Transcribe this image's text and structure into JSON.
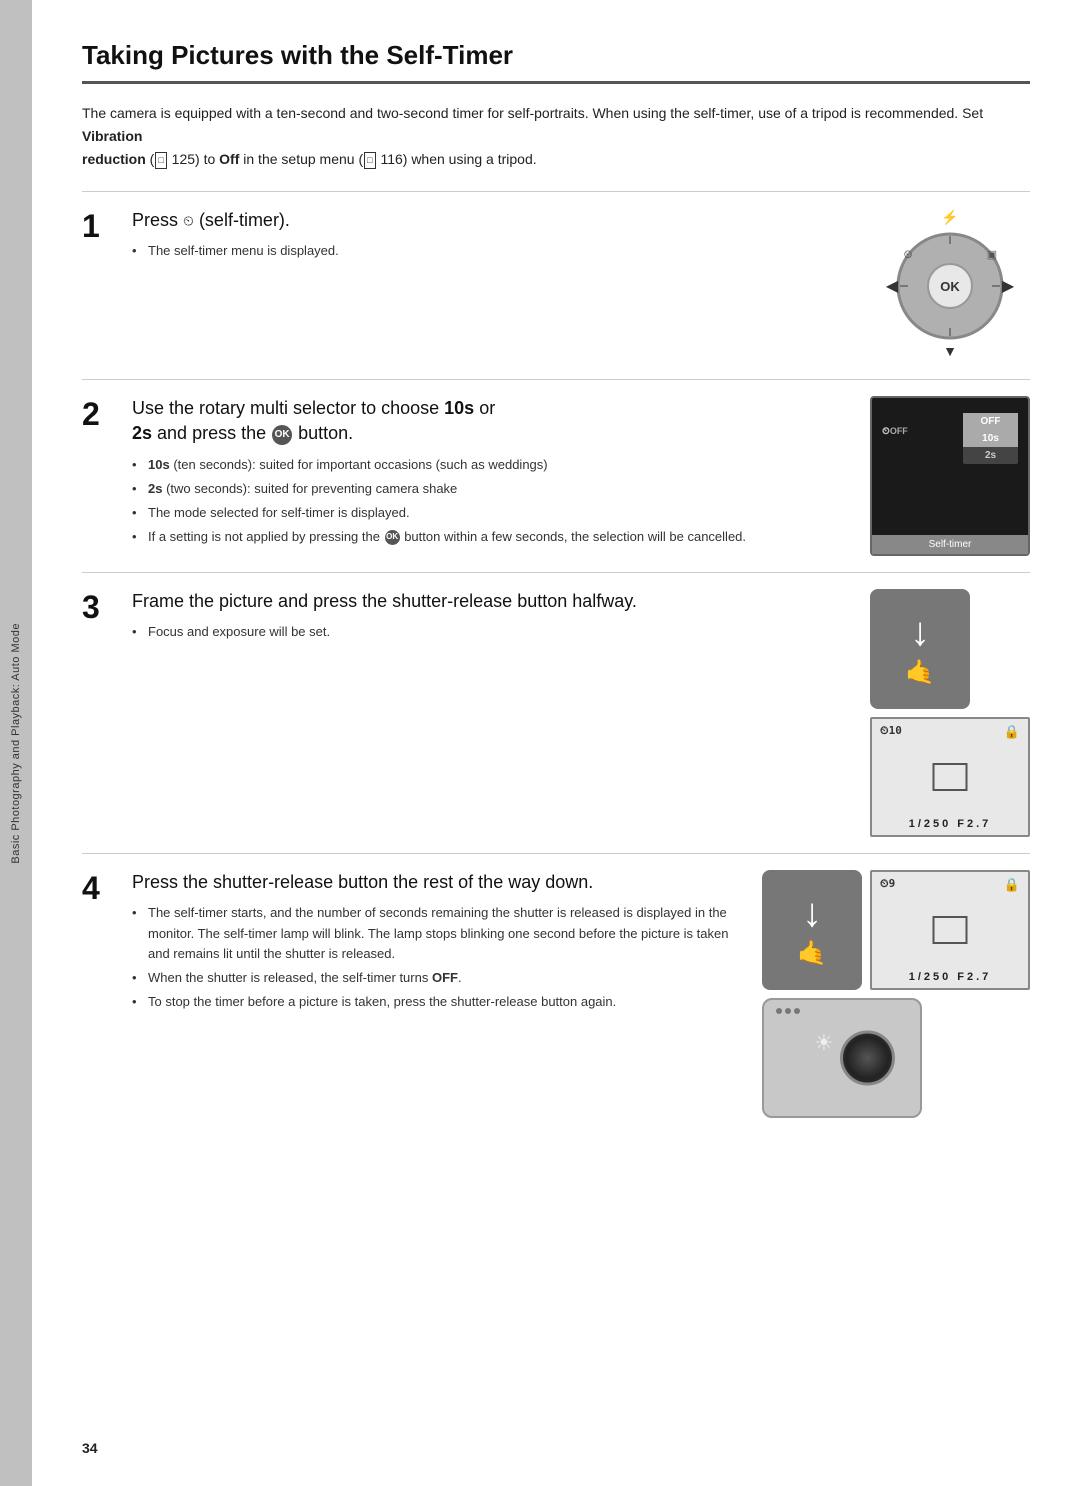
{
  "page": {
    "title": "Taking Pictures with the Self-Timer",
    "page_number": "34",
    "side_label": "Basic Photography and Playback: Auto Mode",
    "intro": {
      "text": "The camera is equipped with a ten-second and two-second timer for self-portraits. When using the self-timer, use of a tripod is recommended. Set ",
      "bold1": "Vibration",
      "bold2": "reduction",
      "text2": " (",
      "ref1": "0",
      "text3": " 125) to ",
      "bold3": "Off",
      "text4": " in the setup menu (",
      "ref2": "0",
      "text5": " 116) when using a tripod."
    },
    "steps": [
      {
        "number": "1",
        "title_pre": "Press ",
        "title_timer_icon": "⏲",
        "title_post": " (self-timer).",
        "bullets": [
          {
            "text": "The self-timer menu is displayed.",
            "bold": ""
          }
        ]
      },
      {
        "number": "2",
        "title_pre": "Use the rotary multi selector to choose ",
        "title_bold": "10s",
        "title_mid": " or ",
        "title_bold2": "2s",
        "title_post": " and press the ",
        "title_ok": "OK",
        "title_end": " button.",
        "bullets": [
          {
            "text": "10s",
            "bold": "10s",
            "rest": " (ten seconds): suited for important occasions (such as weddings)"
          },
          {
            "text": "2s",
            "bold": "2s",
            "rest": " (two seconds): suited for preventing camera shake"
          },
          {
            "text": "The mode selected for self-timer is displayed.",
            "bold": ""
          },
          {
            "text": "If a setting is not applied by pressing the ",
            "bold": "",
            "ok": "OK",
            "rest": " button within a few seconds, the selection will be cancelled."
          }
        ]
      },
      {
        "number": "3",
        "title": "Frame the picture and press the shutter-release button halfway.",
        "bullets": [
          {
            "text": "Focus and exposure will be set.",
            "bold": ""
          }
        ]
      },
      {
        "number": "4",
        "title": "Press the shutter-release button the rest of the way down.",
        "bullets": [
          {
            "text": "The self-timer starts, and the number of seconds remaining the shutter is released is displayed in the monitor. The self-timer lamp will blink. The lamp stops blinking one second before the picture is taken and remains lit until the shutter is released.",
            "bold": ""
          },
          {
            "text": "When the shutter is released, the self-timer turns ",
            "bold": "",
            "boldend": "OFF",
            "rest": "."
          },
          {
            "text": "To stop the timer before a picture is taken, press the shutter-release button again.",
            "bold": ""
          }
        ]
      }
    ],
    "images": {
      "step2_menu": {
        "off_label": "OFF",
        "item1": "10s",
        "item2": "2s",
        "bottom": "Self-timer",
        "left_label": "⏲OFF"
      },
      "step3_vf": {
        "top_left": "⏲10",
        "top_right": "🔒",
        "bottom": "1/250  F2.7"
      },
      "step4_vf": {
        "top_left": "⏲9",
        "top_right": "🔒",
        "bottom": "1/250  F2.7"
      }
    }
  }
}
